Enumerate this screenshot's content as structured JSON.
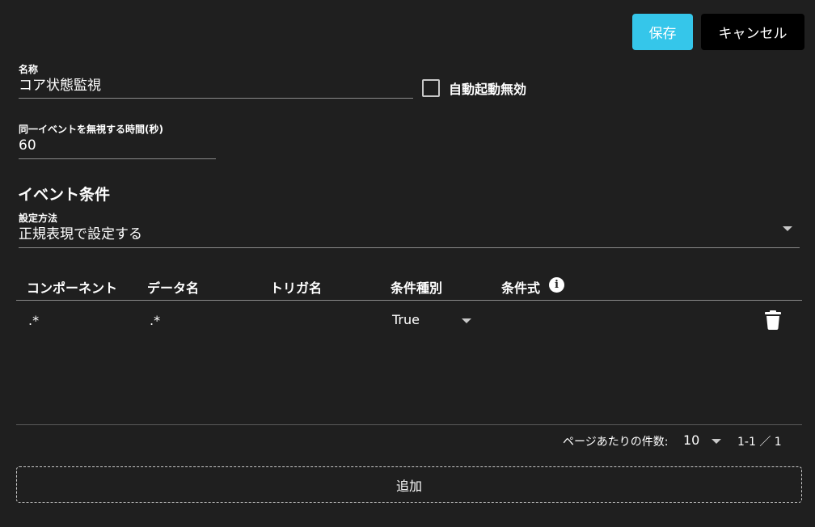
{
  "toolbar": {
    "save_label": "保存",
    "cancel_label": "キャンセル"
  },
  "form": {
    "name": {
      "label": "名称",
      "value": "コア状態監視"
    },
    "auto_start_disabled": {
      "label": "自動起動無効",
      "checked": false
    },
    "ignore_duration": {
      "label": "同一イベントを無視する時間(秒)",
      "value": "60"
    }
  },
  "event_conditions": {
    "title": "イベント条件",
    "method": {
      "label": "設定方法",
      "value": "正規表現で設定する"
    },
    "table": {
      "columns": [
        "コンポーネント",
        "データ名",
        "トリガ名",
        "条件種別",
        "条件式"
      ],
      "rows": [
        {
          "component": ".*",
          "data_name": ".*",
          "trigger_name": "",
          "condition_type": "True",
          "expression": ""
        }
      ]
    },
    "pager": {
      "rows_per_page_label": "ページあたりの件数:",
      "rows_per_page": "10",
      "range": "1-1 ／ 1"
    },
    "add_label": "追加"
  },
  "colors": {
    "background": "#1f1f1f",
    "accent": "#35c6ea",
    "cancel_bg": "#000000"
  },
  "icons": [
    "info-icon",
    "trash-icon",
    "chevron-down-icon"
  ]
}
